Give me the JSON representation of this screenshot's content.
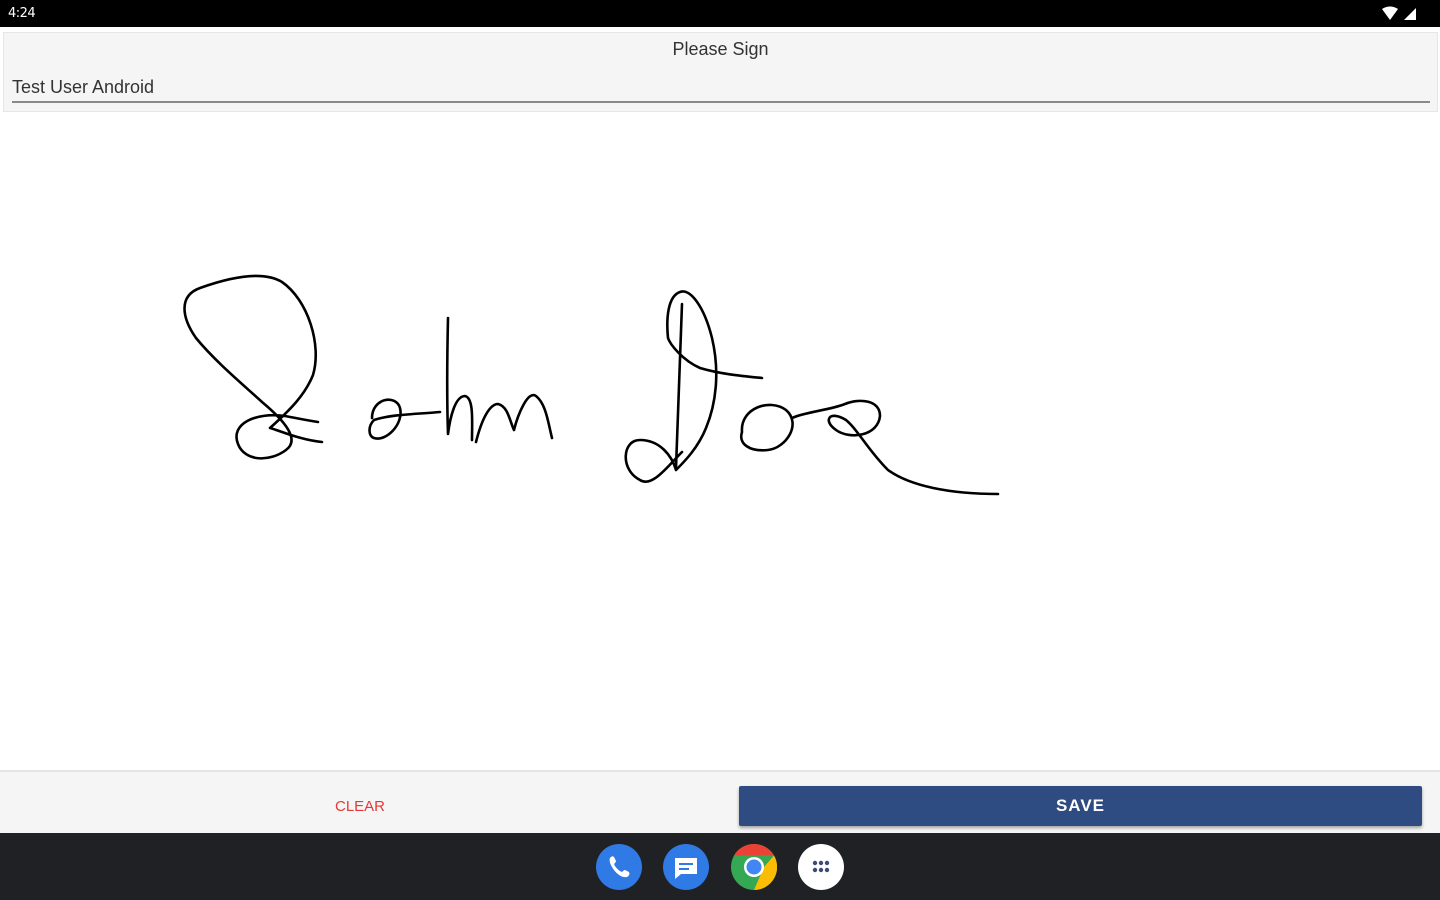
{
  "status_bar": {
    "time": "4:24",
    "icons": [
      "wifi-icon",
      "cell-signal-icon"
    ]
  },
  "header": {
    "title": "Please Sign",
    "signer_name": "Test User Android"
  },
  "signature": {
    "drawn": true,
    "stroke_color": "#000000"
  },
  "actions": {
    "clear_label": "CLEAR",
    "save_label": "SAVE",
    "clear_color": "#e53935",
    "save_color": "#2e4b82"
  },
  "dock": {
    "icons": [
      "phone-icon",
      "messages-icon",
      "chrome-icon",
      "app-drawer-icon"
    ]
  }
}
